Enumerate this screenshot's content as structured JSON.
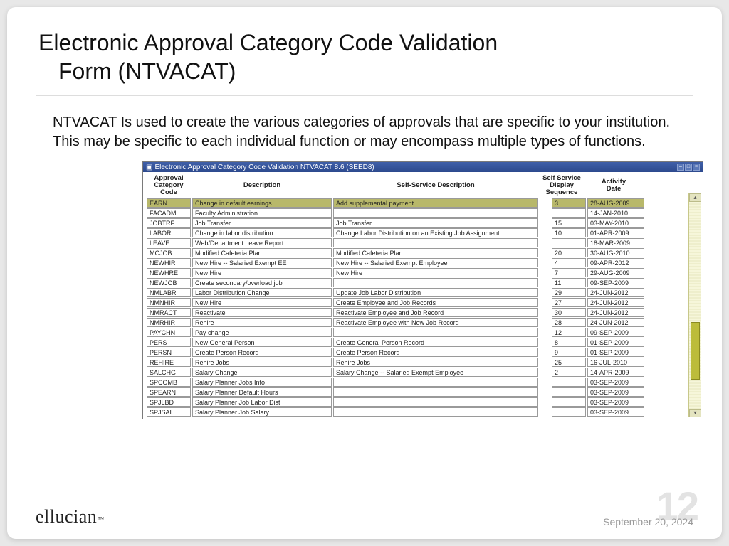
{
  "slide": {
    "title_line1": "Electronic Approval Category Code Validation",
    "title_line2": "Form (NTVACAT)",
    "body": "NTVACAT Is used to create the various categories of approvals that are specific to your institution.  This may be specific to each individual function or may encompass multiple types of functions."
  },
  "window": {
    "title": "Electronic Approval Category Code Validation  NTVACAT  8.6  (SEED8)"
  },
  "columns": {
    "code": "Approval\nCategory\nCode",
    "desc": "Description",
    "ssdesc": "Self-Service Description",
    "seq": "Self Service\nDisplay\nSequence",
    "date": "Activity\nDate"
  },
  "rows": [
    {
      "code": "EARN",
      "desc": "Change in default earnings",
      "ssdesc": "Add supplemental payment",
      "seq": "3",
      "date": "28-AUG-2009",
      "selected": true
    },
    {
      "code": "FACADM",
      "desc": "Faculty Administration",
      "ssdesc": "",
      "seq": "",
      "date": "14-JAN-2010"
    },
    {
      "code": "JOBTRF",
      "desc": "Job Transfer",
      "ssdesc": "Job Transfer",
      "seq": "15",
      "date": "03-MAY-2010"
    },
    {
      "code": "LABOR",
      "desc": "Change in labor distribution",
      "ssdesc": "Change Labor Distribution on an Existing Job Assignment",
      "seq": "10",
      "date": "01-APR-2009"
    },
    {
      "code": "LEAVE",
      "desc": "Web/Department Leave Report",
      "ssdesc": "",
      "seq": "",
      "date": "18-MAR-2009"
    },
    {
      "code": "MCJOB",
      "desc": "Modified Cafeteria Plan",
      "ssdesc": "Modified Cafeteria Plan",
      "seq": "20",
      "date": "30-AUG-2010"
    },
    {
      "code": "NEWHIR",
      "desc": "New Hire -- Salaried Exempt EE",
      "ssdesc": "New Hire -- Salaried Exempt Employee",
      "seq": "4",
      "date": "09-APR-2012"
    },
    {
      "code": "NEWHRE",
      "desc": "New Hire",
      "ssdesc": "New Hire",
      "seq": "7",
      "date": "29-AUG-2009"
    },
    {
      "code": "NEWJOB",
      "desc": "Create secondary/overload job",
      "ssdesc": "",
      "seq": "11",
      "date": "09-SEP-2009"
    },
    {
      "code": "NMLABR",
      "desc": "Labor Distribution Change",
      "ssdesc": "Update Job Labor Distribution",
      "seq": "29",
      "date": "24-JUN-2012"
    },
    {
      "code": "NMNHIR",
      "desc": "New Hire",
      "ssdesc": "Create Employee and Job Records",
      "seq": "27",
      "date": "24-JUN-2012"
    },
    {
      "code": "NMRACT",
      "desc": "Reactivate",
      "ssdesc": "Reactivate Employee and Job Record",
      "seq": "30",
      "date": "24-JUN-2012"
    },
    {
      "code": "NMRHIR",
      "desc": "Rehire",
      "ssdesc": "Reactivate Employee with New Job Record",
      "seq": "28",
      "date": "24-JUN-2012"
    },
    {
      "code": "PAYCHN",
      "desc": "Pay change",
      "ssdesc": "",
      "seq": "12",
      "date": "09-SEP-2009"
    },
    {
      "code": "PERS",
      "desc": "New General Person",
      "ssdesc": "Create General Person Record",
      "seq": "8",
      "date": "01-SEP-2009"
    },
    {
      "code": "PERSN",
      "desc": "Create Person Record",
      "ssdesc": "Create Person Record",
      "seq": "9",
      "date": "01-SEP-2009"
    },
    {
      "code": "REHIRE",
      "desc": "Rehire Jobs",
      "ssdesc": "Rehire Jobs",
      "seq": "25",
      "date": "16-JUL-2010"
    },
    {
      "code": "SALCHG",
      "desc": "Salary Change",
      "ssdesc": "Salary Change -- Salaried Exempt Employee",
      "seq": "2",
      "date": "14-APR-2009"
    },
    {
      "code": "SPCOMB",
      "desc": "Salary Planner Jobs Info",
      "ssdesc": "",
      "seq": "",
      "date": "03-SEP-2009"
    },
    {
      "code": "SPEARN",
      "desc": "Salary Planner Default Hours",
      "ssdesc": "",
      "seq": "",
      "date": "03-SEP-2009"
    },
    {
      "code": "SPJLBD",
      "desc": "Salary Planner Job Labor Dist",
      "ssdesc": "",
      "seq": "",
      "date": "03-SEP-2009"
    },
    {
      "code": "SPJSAL",
      "desc": "Salary Planner Job Salary",
      "ssdesc": "",
      "seq": "",
      "date": "03-SEP-2009"
    }
  ],
  "footer": {
    "logo": "ellucian",
    "date": "September 20, 2024",
    "page": "12"
  }
}
